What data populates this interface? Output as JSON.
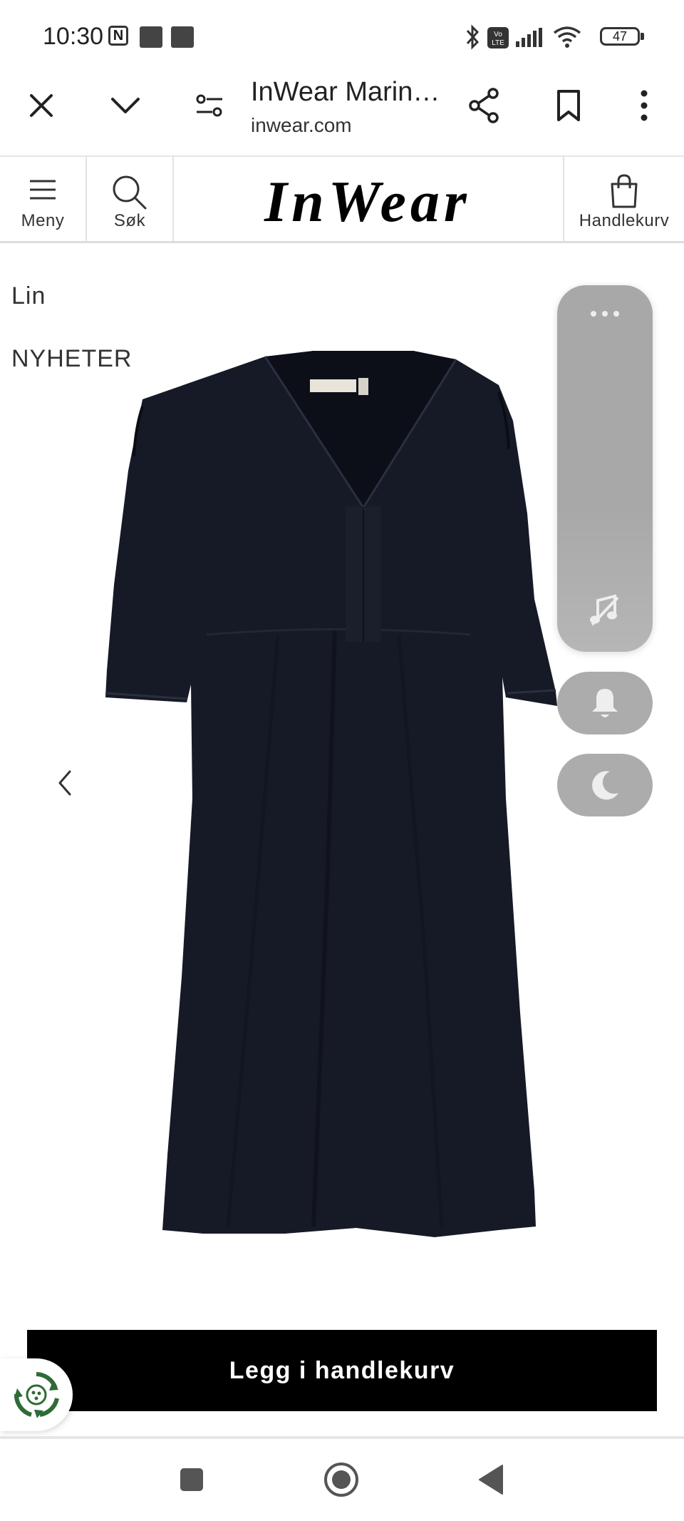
{
  "status_bar": {
    "time": "10:30",
    "nfc_label": "N",
    "battery": "47"
  },
  "browser": {
    "title": "InWear Marin…",
    "url": "inwear.com"
  },
  "site_header": {
    "menu_label": "Meny",
    "search_label": "Søk",
    "logo_text": "InWear",
    "cart_label": "Handlekurv"
  },
  "product": {
    "tags": [
      "Lin",
      "NYHETER"
    ],
    "add_to_cart_label": "Legg i handlekurv"
  },
  "colors": {
    "accent": "#000000",
    "dress": "#161a26",
    "float_panel": "#a8a8a8",
    "eco_green": "#2e6b36"
  },
  "icons": {
    "close": "close-icon",
    "expand": "chevron-down-icon",
    "settings": "tune-icon",
    "share": "share-icon",
    "bookmark": "bookmark-icon",
    "more": "more-vert-icon",
    "menu": "hamburger-icon",
    "search": "search-icon",
    "cart": "shopping-bag-icon",
    "prev": "chevron-left-icon",
    "music_off": "music-off-icon",
    "bell": "bell-icon",
    "moon": "moon-icon"
  }
}
